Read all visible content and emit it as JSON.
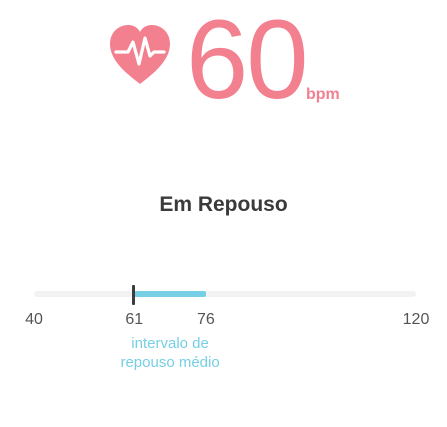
{
  "heart_rate": {
    "icon": "heart-pulse-icon",
    "value": "60",
    "unit": "bpm",
    "color": "#f3808f"
  },
  "state": {
    "label": "Em Repouso"
  },
  "range": {
    "min": 40,
    "max": 120,
    "current": 61,
    "average_low": 61,
    "average_high": 76,
    "tick_labels": [
      "40",
      "61",
      "76",
      "120"
    ],
    "caption_line1": "intervalo de",
    "caption_line2": "repouso médio",
    "accent_color": "#76cfe5",
    "track_color": "#f2f2f2"
  }
}
